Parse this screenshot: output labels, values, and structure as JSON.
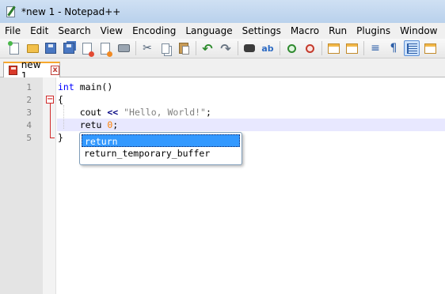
{
  "window": {
    "title": "*new 1 - Notepad++"
  },
  "menu": {
    "items": [
      "File",
      "Edit",
      "Search",
      "View",
      "Encoding",
      "Language",
      "Settings",
      "Macro",
      "Run",
      "Plugins",
      "Window",
      "?"
    ],
    "close_glyph": "X"
  },
  "toolbar": {
    "buttons": [
      "new-file-icon",
      "open-folder-icon",
      "save-icon",
      "save-all-icon",
      "close-file-icon",
      "close-all-icon",
      "print-icon",
      "cut-icon",
      "copy-icon",
      "paste-icon",
      "undo-icon",
      "redo-icon",
      "find-icon",
      "replace-icon",
      "zoom-in-icon",
      "zoom-out-icon",
      "sync-vertical-icon",
      "sync-horizontal-icon",
      "word-wrap-icon",
      "show-all-chars-icon",
      "indent-guide-icon",
      "more-icon"
    ]
  },
  "tabs": [
    {
      "label": "new 1",
      "close_glyph": "x",
      "active": true
    }
  ],
  "editor": {
    "line_numbers": [
      "1",
      "2",
      "3",
      "4",
      "5"
    ],
    "lines": [
      {
        "kw": "int",
        "text": " main()"
      },
      {
        "text": "{"
      },
      {
        "indent": "    ",
        "ident": "cout ",
        "op": "<<",
        "str": " \"Hello, World!\"",
        "tail": ";"
      },
      {
        "indent": "    ",
        "ident": "retu ",
        "num": "0",
        "tail": ";"
      },
      {
        "text": "}"
      }
    ],
    "fold_glyph": "−"
  },
  "autocomplete": {
    "items": [
      "return",
      "return_temporary_buffer"
    ],
    "selected_index": 0
  },
  "colors": {
    "keyword": "#0000ff",
    "string": "#808080",
    "number": "#ff8000",
    "selection": "#3399ff",
    "caret_line": "#e8e8ff",
    "fold_marker": "#d12c2c"
  }
}
